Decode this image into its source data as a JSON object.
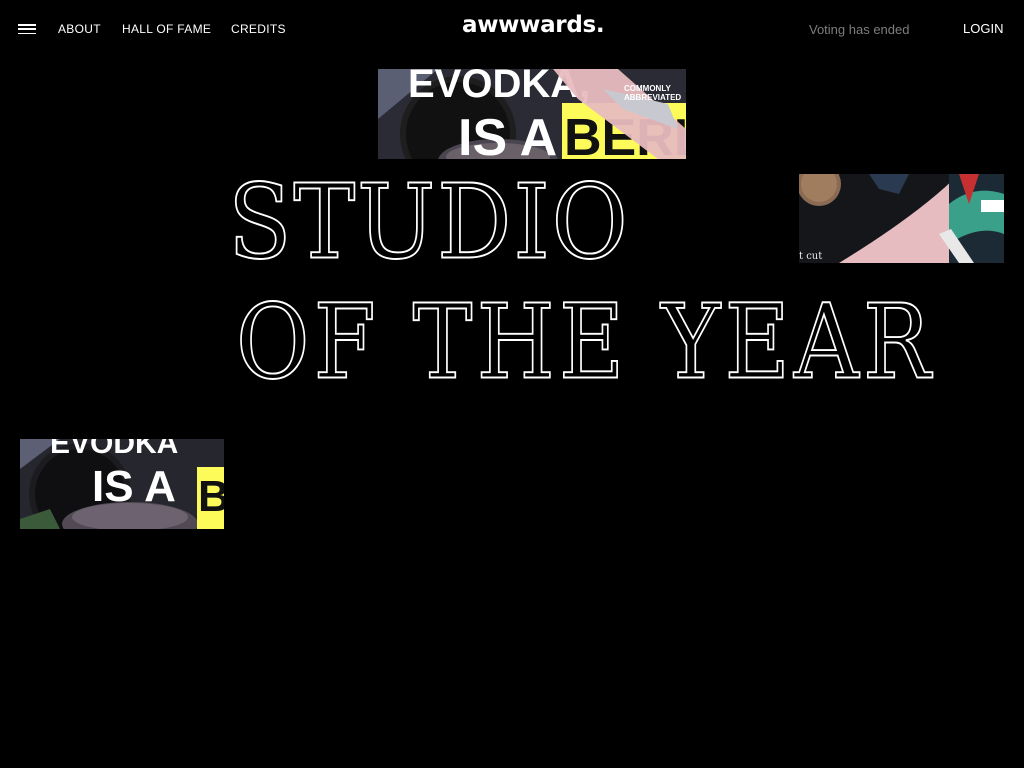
{
  "header": {
    "menu_icon": "hamburger-menu-icon",
    "nav": [
      {
        "label": "ABOUT"
      },
      {
        "label": "HALL OF FAME"
      },
      {
        "label": "CREDITS"
      }
    ],
    "logo": "awwwards.",
    "voting_status": "Voting has ended",
    "login": "LOGIN"
  },
  "hero": {
    "line1": "STUDIO",
    "line2": "OF THE YEAR"
  },
  "thumbnails": {
    "top": {
      "headline_1": "EVODKA,",
      "headline_2": "IS A",
      "headline_3": "BERL",
      "caption_1": "COMMONLY",
      "caption_2": "ABBREVIATED"
    },
    "right": {
      "caption": "t cut"
    },
    "left": {
      "headline_1": "EVODKA",
      "headline_2": "IS A",
      "headline_3": "B"
    }
  },
  "colors": {
    "background": "#000000",
    "text": "#ffffff",
    "muted": "#7d7d7d",
    "accent_yellow": "#fdfb5a",
    "accent_pink": "#e8bcc0"
  }
}
